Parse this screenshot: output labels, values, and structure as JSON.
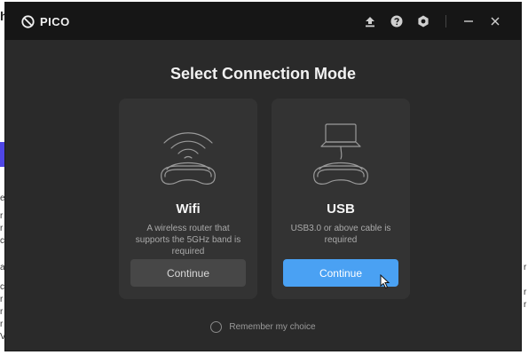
{
  "background": {
    "title_fragment": "h",
    "fragments": [
      "el",
      "r",
      "r",
      "c",
      "a",
      "c",
      "r",
      "r",
      "r",
      "V"
    ],
    "right_fragments": [
      "r",
      "r",
      "r"
    ]
  },
  "window": {
    "brand": "PICO",
    "icons": [
      "upload-icon",
      "help-icon",
      "settings-icon",
      "minimize-icon",
      "close-icon"
    ]
  },
  "heading": "Select Connection Mode",
  "cards": [
    {
      "title": "Wifi",
      "description": "A wireless router that supports the 5GHz band is required",
      "button_label": "Continue",
      "button_style": "grey",
      "icon": "wifi-headset-icon"
    },
    {
      "title": "USB",
      "description": "USB3.0 or above cable is required",
      "button_label": "Continue",
      "button_style": "blue",
      "icon": "usb-headset-icon"
    }
  ],
  "remember": {
    "label": "Remember my choice",
    "checked": false
  },
  "colors": {
    "window_bg": "#2a2a2a",
    "titlebar_bg": "#161616",
    "card_bg": "#333333",
    "accent": "#4aa1f3",
    "secondary_button": "#474747"
  }
}
